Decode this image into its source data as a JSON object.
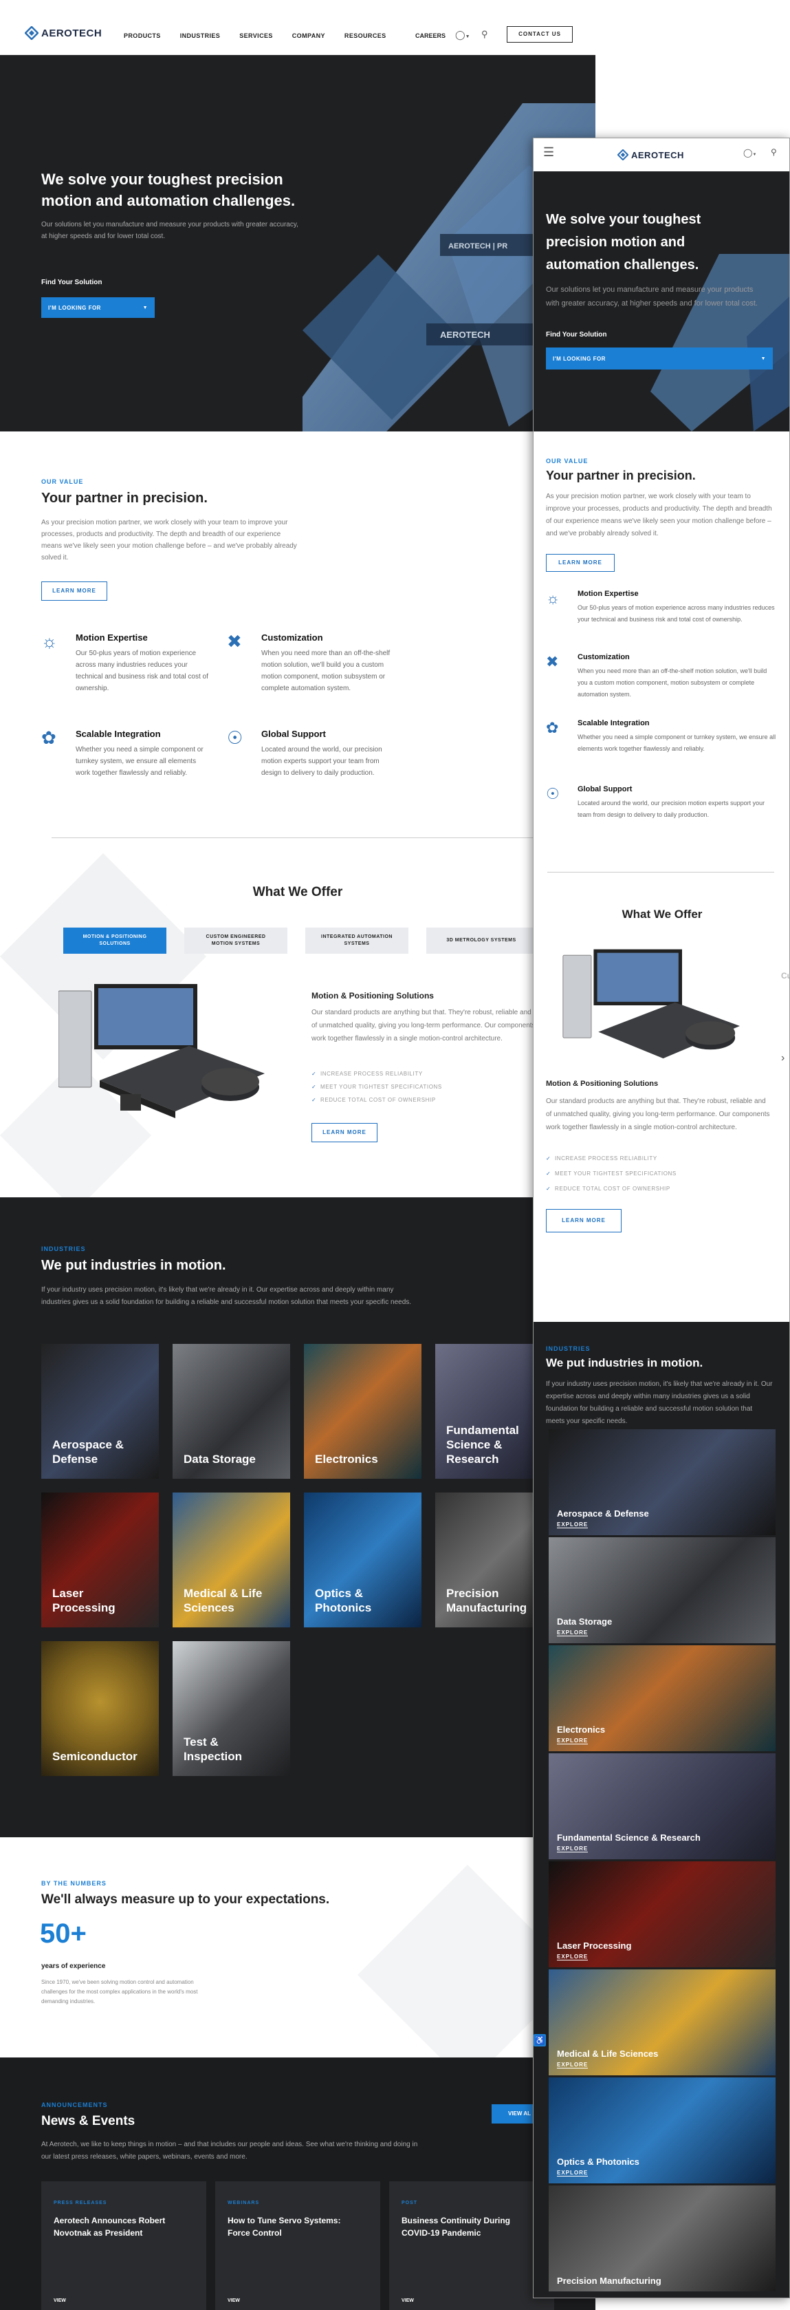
{
  "brand": {
    "name": "AEROTECH",
    "accent": "#1b7fd4",
    "dark": "#1e1f21"
  },
  "header": {
    "nav": [
      "PRODUCTS",
      "INDUSTRIES",
      "SERVICES",
      "COMPANY",
      "RESOURCES"
    ],
    "careers": "CAREERS",
    "contact": "CONTACT US",
    "globe_icon": "globe-icon",
    "search_icon": "search-icon"
  },
  "hero": {
    "title": "We solve your toughest precision motion and automation challenges.",
    "text": "Our solutions let you manufacture and measure your products with greater accuracy, at higher speeds and for lower total cost.",
    "find_label": "Find Your Solution",
    "select_label": "I'M LOOKING FOR"
  },
  "value": {
    "eyebrow": "OUR VALUE",
    "title": "Your partner in precision.",
    "text": "As your precision motion partner, we work closely with your team to improve your processes, products and productivity. The depth and breadth of our experience means we've likely seen your motion challenge before – and we've probably already solved it.",
    "button": "LEARN MORE",
    "features": [
      {
        "title": "Motion Expertise",
        "text": "Our 50-plus years of motion experience across many industries reduces your technical and business risk and total cost of ownership.",
        "icon": "lightbulb-icon"
      },
      {
        "title": "Customization",
        "text": "When you need more than an off-the-shelf motion solution, we'll build you a custom motion component, motion subsystem or complete automation system.",
        "icon": "tools-icon"
      },
      {
        "title": "Scalable Integration",
        "text": "Whether you need a simple component or turnkey system, we ensure all elements work together flawlessly and reliably.",
        "icon": "integration-icon"
      },
      {
        "title": "Global Support",
        "text": "Located around the world, our precision motion experts support your team from design to delivery to daily production.",
        "icon": "globe-support-icon"
      }
    ]
  },
  "offer": {
    "title": "What We Offer",
    "tabs": [
      "MOTION & POSITIONING SOLUTIONS",
      "CUSTOM ENGINEERED MOTION SYSTEMS",
      "INTEGRATED AUTOMATION SYSTEMS",
      "3D METROLOGY SYSTEMS"
    ],
    "product_title": "Motion & Positioning Solutions",
    "product_text": "Our standard products are anything but that. They're robust, reliable and of unmatched quality, giving you long-term performance. Our components work together flawlessly in a single motion-control architecture.",
    "checks": [
      "INCREASE PROCESS RELIABILITY",
      "MEET YOUR TIGHTEST SPECIFICATIONS",
      "REDUCE TOTAL COST OF OWNERSHIP"
    ],
    "button": "LEARN MORE"
  },
  "industries": {
    "eyebrow": "INDUSTRIES",
    "title": "We put industries in motion.",
    "text": "If your industry uses precision motion, it's likely that we're already in it. Our expertise across and deeply within many industries gives us a solid foundation for building a reliable and successful motion solution that meets your specific needs.",
    "tiles": [
      "Aerospace & Defense",
      "Data Storage",
      "Electronics",
      "Fundamental Science & Research",
      "Laser Processing",
      "Medical & Life Sciences",
      "Optics & Photonics",
      "Precision Manufacturing",
      "Semiconductor",
      "Test & Inspection"
    ],
    "explore": "EXPLORE"
  },
  "numbers": {
    "eyebrow": "BY THE NUMBERS",
    "title": "We'll always measure up to your expectations.",
    "value": "50+",
    "label": "years of experience",
    "text": "Since 1970, we've been solving motion control and automation challenges for the most complex applications in the world's most demanding industries."
  },
  "news": {
    "eyebrow": "ANNOUNCEMENTS",
    "title": "News & Events",
    "text": "At Aerotech, we like to keep things in motion – and that includes our people and ideas. See what we're thinking and doing in our latest press releases, white papers, webinars, events and more.",
    "view_all": "VIEW AL",
    "cards": [
      {
        "tag": "PRESS RELEASES",
        "title": "Aerotech Announces Robert Novotnak as President",
        "link": "VIEW"
      },
      {
        "tag": "WEBINARS",
        "title": "How to Tune Servo Systems: Force Control",
        "link": "VIEW"
      },
      {
        "tag": "POST",
        "title": "Business Continuity During COVID-19 Pandemic",
        "link": "VIEW"
      }
    ]
  },
  "mobile": {
    "menu_icon": "hamburger-icon",
    "accessibility_icon": "accessibility-icon",
    "partial_heading": "Cu"
  }
}
